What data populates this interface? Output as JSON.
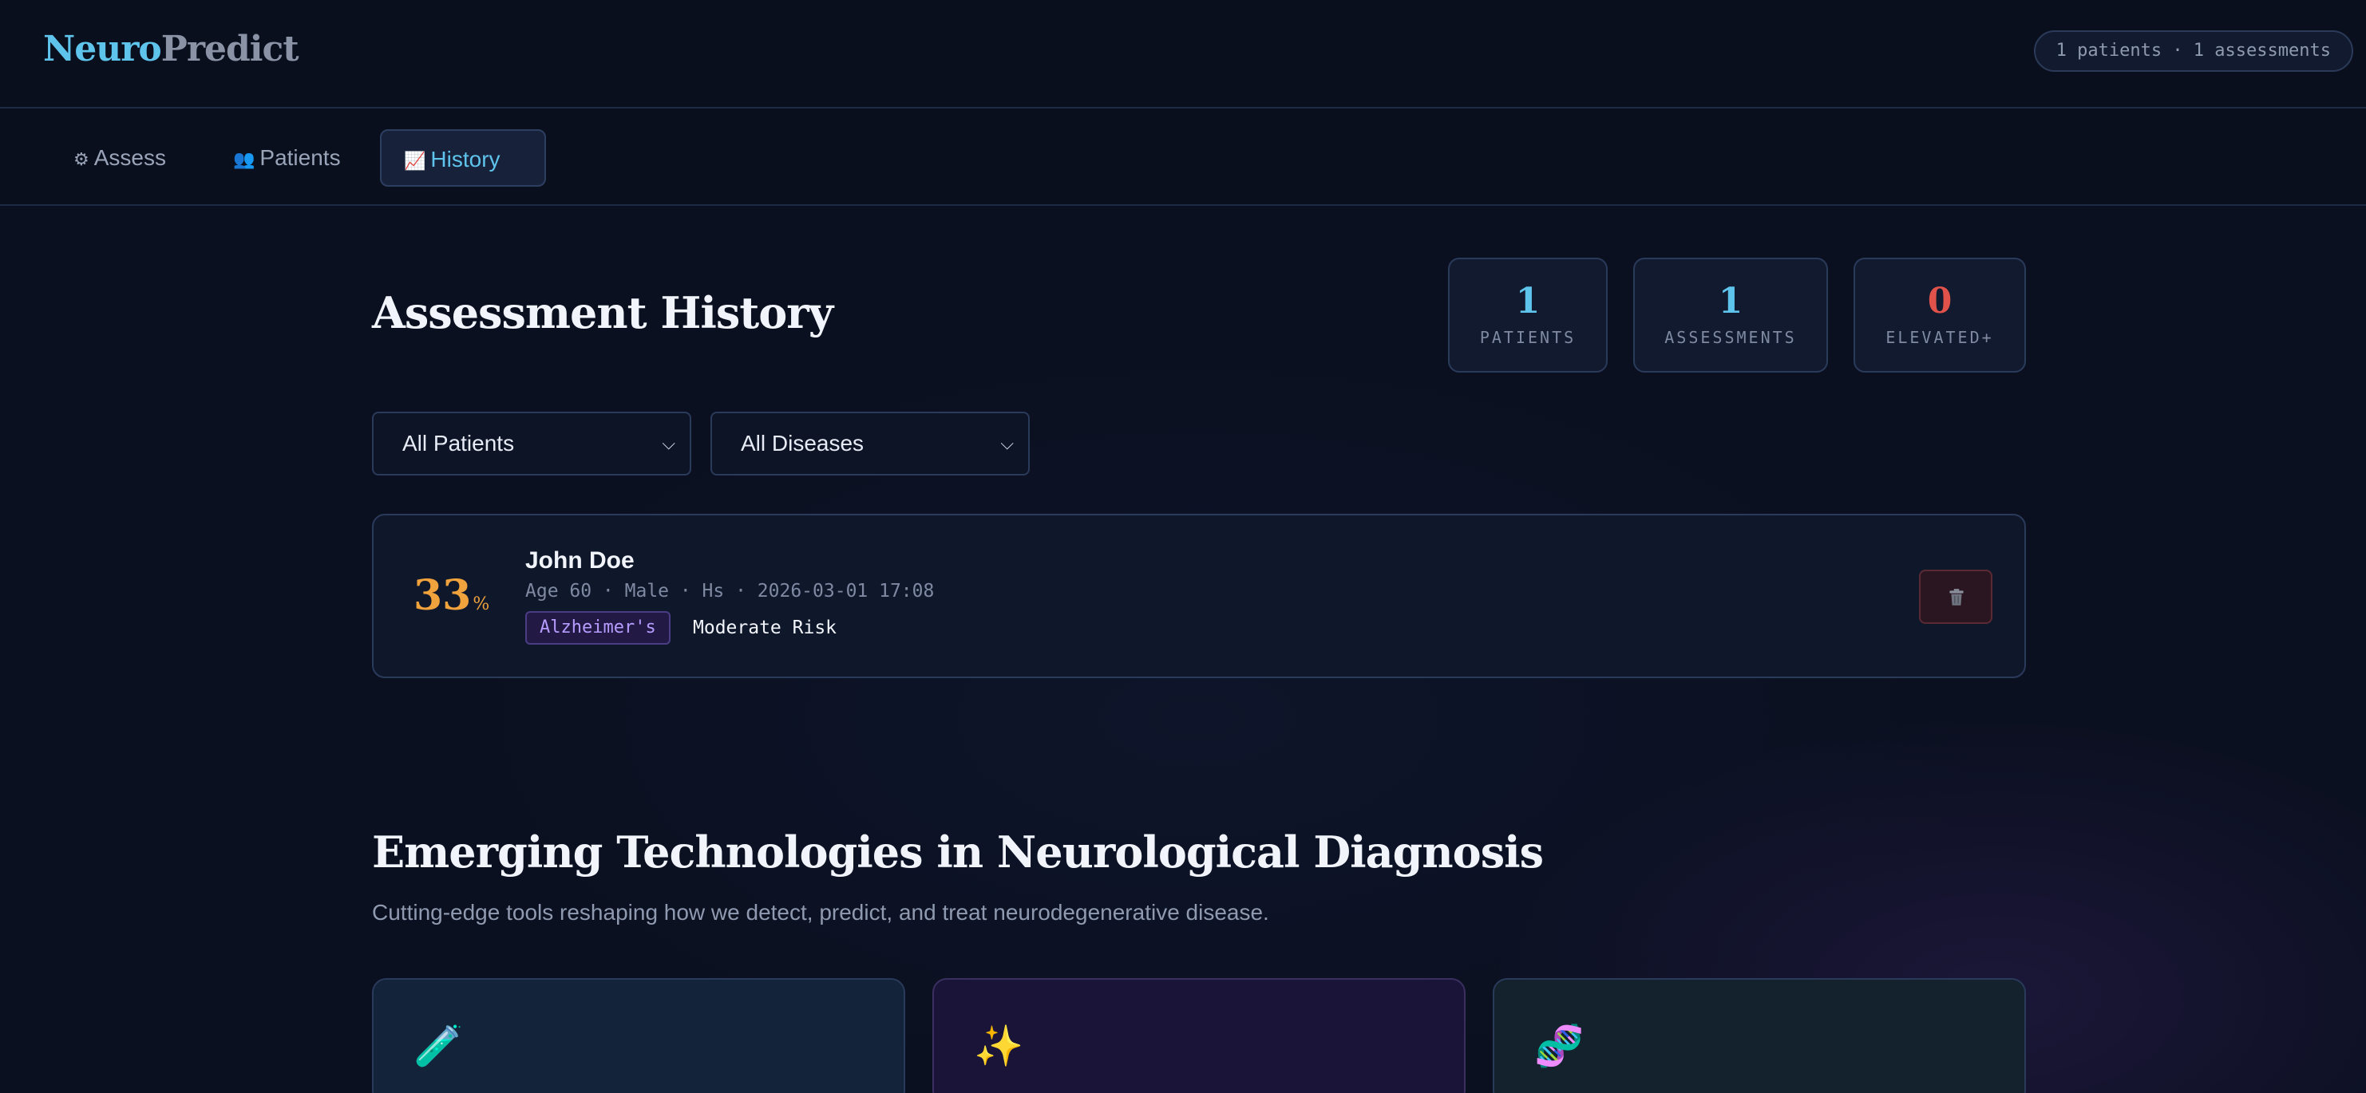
{
  "header": {
    "brand_part1": "Neuro",
    "brand_part2": "Predict",
    "summary": "1 patients · 1 assessments"
  },
  "nav": {
    "tabs": [
      {
        "icon": "⚙",
        "label": "Assess",
        "active": false
      },
      {
        "icon": "👥",
        "label": "Patients",
        "active": false
      },
      {
        "icon": "📈",
        "label": "History",
        "active": true
      }
    ]
  },
  "history": {
    "title": "Assessment History",
    "stats": [
      {
        "value": "1",
        "label": "PATIENTS",
        "color": "#5fc4ec"
      },
      {
        "value": "1",
        "label": "ASSESSMENTS",
        "color": "#5fc4ec"
      },
      {
        "value": "0",
        "label": "ELEVATED+",
        "color": "#e0524a"
      }
    ],
    "filters": {
      "patient": "All Patients",
      "disease": "All Diseases"
    },
    "records": [
      {
        "percent": "33",
        "percent_unit": "%",
        "name": "John Doe",
        "meta": "Age 60 · Male · Hs · 2026-03-01 17:08",
        "disease_tag": "Alzheimer's",
        "risk_label": "Moderate Risk"
      }
    ]
  },
  "emerging": {
    "title": "Emerging Technologies in Neurological Diagnosis",
    "subtitle": "Cutting-edge tools reshaping how we detect, predict, and treat neurodegenerative disease.",
    "cards": [
      {
        "icon": "🧪"
      },
      {
        "icon": "✨"
      },
      {
        "icon": "🧬"
      }
    ]
  }
}
